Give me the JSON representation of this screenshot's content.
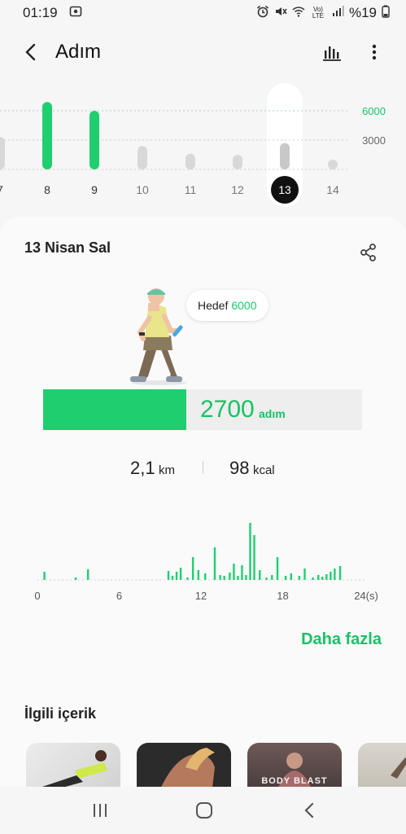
{
  "status_bar": {
    "time": "01:19",
    "signal_label": "Vo)\nLTE",
    "battery": "%19",
    "icons": [
      "screenshot-icon",
      "alarm-icon",
      "mute-icon",
      "wifi-icon",
      "signal-icon",
      "battery-icon"
    ]
  },
  "app_bar": {
    "title": "Adım",
    "icons": [
      "back-arrow-icon",
      "bar-chart-icon",
      "more-vert-icon"
    ]
  },
  "week_chart": {
    "days": [
      "7",
      "8",
      "9",
      "10",
      "11",
      "12",
      "13",
      "14"
    ],
    "selected_day": "13",
    "goal_line_label": "6000",
    "mid_line_label": "3000",
    "day_steps": [
      null,
      6900,
      6000,
      2400,
      1600,
      1500,
      2700,
      300
    ],
    "goal_met": [
      false,
      true,
      true,
      false,
      false,
      false,
      false,
      false
    ]
  },
  "card": {
    "date": "13 Nisan Sal",
    "goal_label": "Hedef",
    "goal_value": "6000",
    "steps_value": "2700",
    "steps_unit": "adım",
    "progress_fraction": 0.45,
    "distance_value": "2,1",
    "distance_unit": "km",
    "calories_value": "98",
    "calories_unit": "kcal",
    "more_label": "Daha fazla",
    "related_title": "İlgili içerik",
    "related_thumbs": [
      "woman-stretch",
      "arm-workout",
      "body-blast",
      "beach-runner"
    ]
  },
  "hourly": {
    "x_labels": [
      "0",
      "6",
      "12",
      "18",
      "24(s)"
    ],
    "bars": [
      [
        0.5,
        10
      ],
      [
        2.8,
        3
      ],
      [
        3.7,
        13
      ],
      [
        9.6,
        11
      ],
      [
        9.9,
        5
      ],
      [
        10.2,
        10
      ],
      [
        10.5,
        15
      ],
      [
        11.0,
        3
      ],
      [
        11.4,
        28
      ],
      [
        11.8,
        12
      ],
      [
        12.3,
        8
      ],
      [
        13.0,
        40
      ],
      [
        13.4,
        6
      ],
      [
        13.7,
        5
      ],
      [
        14.1,
        9
      ],
      [
        14.4,
        20
      ],
      [
        14.7,
        5
      ],
      [
        15.0,
        18
      ],
      [
        15.3,
        6
      ],
      [
        15.6,
        70
      ],
      [
        15.9,
        55
      ],
      [
        16.3,
        12
      ],
      [
        16.8,
        3
      ],
      [
        17.2,
        6
      ],
      [
        17.6,
        28
      ],
      [
        18.2,
        5
      ],
      [
        18.6,
        8
      ],
      [
        19.2,
        5
      ],
      [
        19.6,
        14
      ],
      [
        20.2,
        3
      ],
      [
        20.6,
        6
      ],
      [
        20.9,
        4
      ],
      [
        21.2,
        7
      ],
      [
        21.5,
        10
      ],
      [
        21.8,
        14
      ],
      [
        22.2,
        17
      ]
    ]
  }
}
